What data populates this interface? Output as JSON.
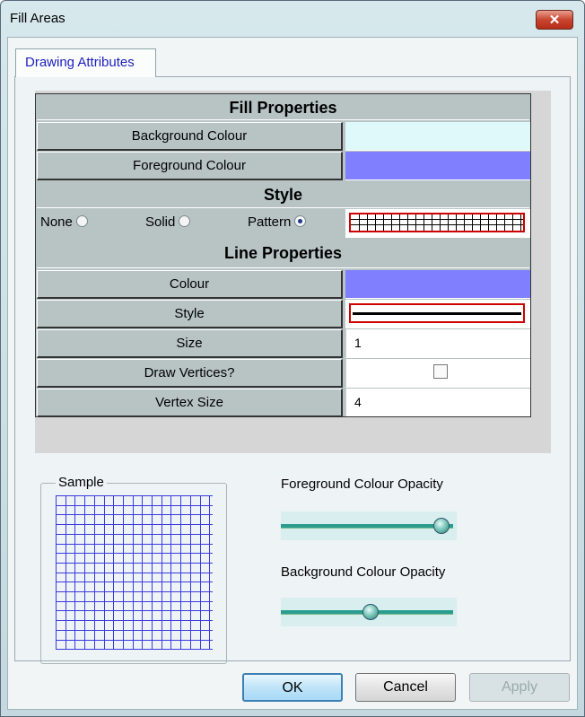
{
  "window": {
    "title": "Fill Areas",
    "close_glyph": "✕"
  },
  "tabs": [
    {
      "label": "Drawing Attributes",
      "active": true
    }
  ],
  "fill_properties": {
    "header": "Fill Properties",
    "background_colour": {
      "label": "Background Colour",
      "value": "#dff9fb"
    },
    "foreground_colour": {
      "label": "Foreground Colour",
      "value": "#8080ff"
    }
  },
  "style": {
    "header": "Style",
    "options": [
      {
        "label": "None",
        "selected": false
      },
      {
        "label": "Solid",
        "selected": false
      },
      {
        "label": "Pattern",
        "selected": true
      }
    ],
    "pattern_preview": "grid"
  },
  "line_properties": {
    "header": "Line Properties",
    "colour": {
      "label": "Colour",
      "value": "#8080ff"
    },
    "style": {
      "label": "Style",
      "value": "solid"
    },
    "size": {
      "label": "Size",
      "value": "1"
    },
    "draw_vertices": {
      "label": "Draw Vertices?",
      "checked": false
    },
    "vertex_size": {
      "label": "Vertex Size",
      "value": "4"
    }
  },
  "sample": {
    "label": "Sample",
    "pattern": "grid",
    "line_colour": "#3a3ae0"
  },
  "opacity": {
    "foreground": {
      "label": "Foreground Colour Opacity",
      "value": 1.0
    },
    "background": {
      "label": "Background Colour Opacity",
      "value": 0.5
    }
  },
  "buttons": {
    "ok": "OK",
    "cancel": "Cancel",
    "apply": "Apply"
  }
}
